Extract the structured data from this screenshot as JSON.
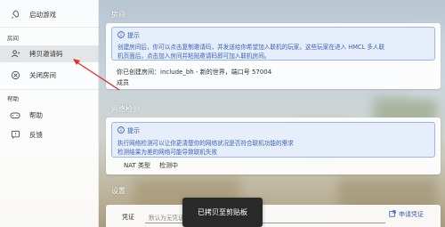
{
  "sidebar": {
    "items": [
      {
        "label": "启动游戏",
        "icon": "rocket-icon"
      },
      {
        "label": "拷贝邀请码",
        "icon": "user-copy-icon"
      },
      {
        "label": "关闭房间",
        "icon": "close-circle-icon"
      },
      {
        "label": "帮助",
        "icon": "gamepad-icon"
      },
      {
        "label": "反馈",
        "icon": "feedback-icon"
      }
    ],
    "sections": {
      "room": "房间",
      "help": "帮助"
    }
  },
  "room": {
    "title": "房间",
    "tip_head": "提示",
    "tip_lines": [
      "创建房间后，你可以点击复制邀请码，并发送给你希望加入联机的玩家。这些玩家在进入 HMCL 多人联",
      "机页面后，点击加入房间并粘贴邀请码即可加入联机房间。"
    ],
    "created": "你已创建房间：include_bh - 新的世界，端口号 57004",
    "members": "成员"
  },
  "network": {
    "title": "网络检测",
    "tip_head": "提示",
    "tip_lines": [
      "执行网络检测可以让你更清楚你的网络状况是否符合联机功能的需求",
      "检测结果为差的网络可能导致联机失败"
    ],
    "nat_label": "NAT 类型",
    "nat_value": "检测中"
  },
  "settings": {
    "title": "设置",
    "voucher_label": "凭证",
    "voucher_placeholder": "默认为无凭证，你也可以点击兑换凭证",
    "apply_label": "申请凭证"
  },
  "toast": {
    "text": "已拷贝至剪贴板"
  },
  "colors": {
    "accent": "#2f5bb5",
    "arrow": "#e03030"
  }
}
